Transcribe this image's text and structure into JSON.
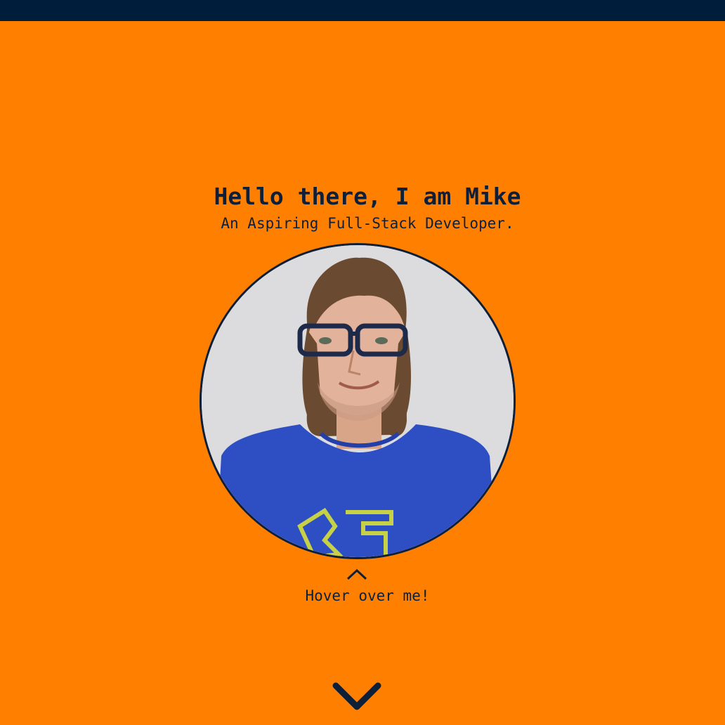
{
  "header": {
    "title": "Hello there, I am Mike",
    "subtitle": "An Aspiring Full-Stack Developer."
  },
  "avatar": {
    "alt": "Portrait photo of Mike"
  },
  "hover_hint": {
    "icon": "chevron-up-icon",
    "text": "Hover over me!"
  },
  "scroll": {
    "icon": "chevron-down-icon"
  },
  "colors": {
    "background": "#FF8000",
    "accent_dark": "#001E3C",
    "text": "#0E1F3A"
  }
}
